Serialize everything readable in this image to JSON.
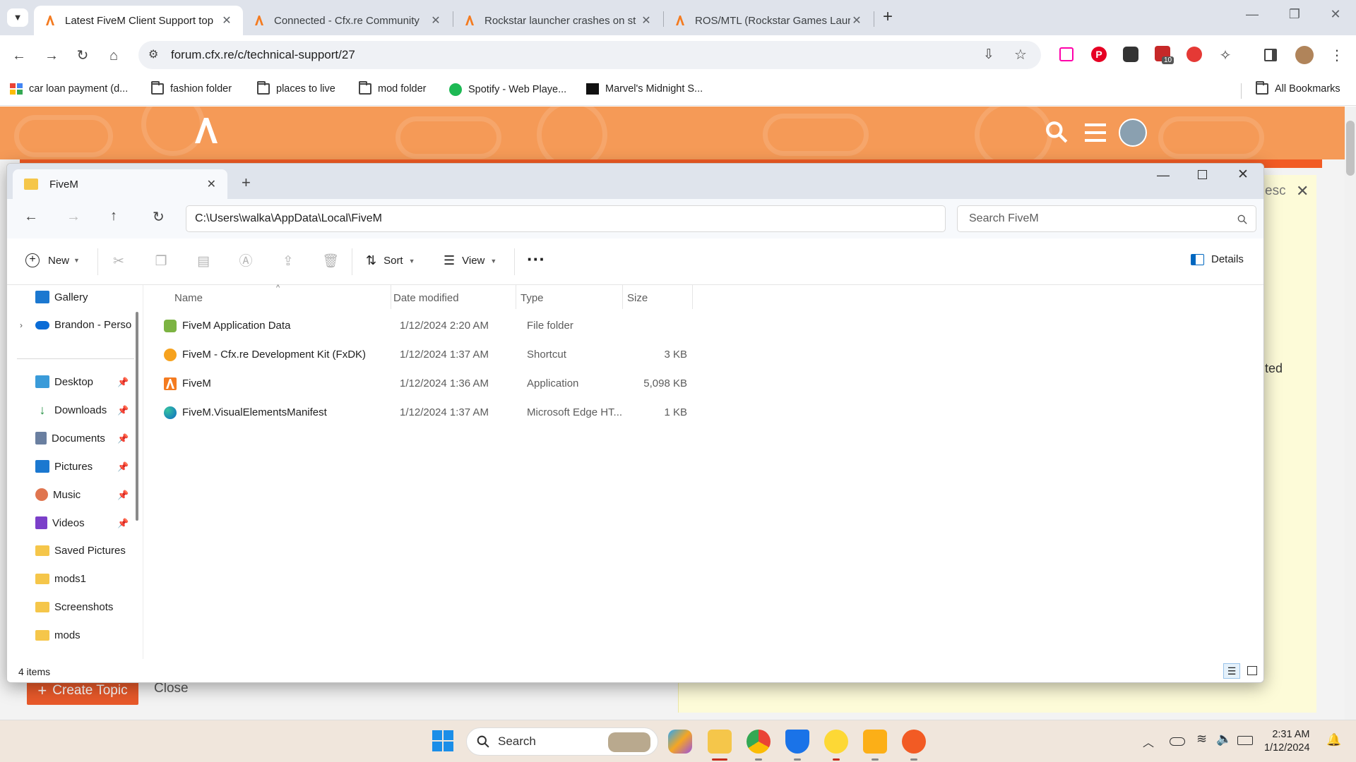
{
  "browser": {
    "tabs": [
      {
        "title": "Latest FiveM Client Support top",
        "active": true
      },
      {
        "title": "Connected - Cfx.re Community",
        "active": false
      },
      {
        "title": "Rockstar launcher crashes on st",
        "active": false
      },
      {
        "title": "ROS/MTL (Rockstar Games Laur",
        "active": false
      }
    ],
    "new_tab_label": "+",
    "url": "forum.cfx.re/c/technical-support/27",
    "extension_badge": "10",
    "bookmarks": [
      {
        "label": "car loan payment (d...",
        "icon": "apps-icon"
      },
      {
        "label": "fashion folder",
        "icon": "folder-icon"
      },
      {
        "label": "places to live",
        "icon": "folder-icon"
      },
      {
        "label": "mod folder",
        "icon": "folder-icon"
      },
      {
        "label": "Spotify - Web Playe...",
        "icon": "spotify-icon"
      },
      {
        "label": "Marvel's Midnight S...",
        "icon": "game-icon"
      }
    ],
    "all_bookmarks_label": "All Bookmarks"
  },
  "page": {
    "esc_label": "esc",
    "partial_text": "ted",
    "create_topic_label": "Create Topic",
    "close_label": "Close",
    "accent_color": "#f59a57"
  },
  "explorer": {
    "tab_title": "FiveM",
    "address": "C:\\Users\\walka\\AppData\\Local\\FiveM",
    "search_placeholder": "Search FiveM",
    "commands": {
      "new_label": "New",
      "sort_label": "Sort",
      "view_label": "View",
      "more_label": "···",
      "details_label": "Details"
    },
    "nav": [
      {
        "label": "Gallery",
        "icon": "gallery-icon",
        "pinned": false
      },
      {
        "label": "Brandon - Perso",
        "icon": "onedrive-icon",
        "pinned": false
      },
      {
        "label": "Desktop",
        "icon": "desktop-icon",
        "pinned": true
      },
      {
        "label": "Downloads",
        "icon": "downloads-icon",
        "pinned": true
      },
      {
        "label": "Documents",
        "icon": "documents-icon",
        "pinned": true
      },
      {
        "label": "Pictures",
        "icon": "pictures-icon",
        "pinned": true
      },
      {
        "label": "Music",
        "icon": "music-icon",
        "pinned": true
      },
      {
        "label": "Videos",
        "icon": "videos-icon",
        "pinned": true
      },
      {
        "label": "Saved Pictures",
        "icon": "folder-icon",
        "pinned": false
      },
      {
        "label": "mods1",
        "icon": "folder-icon",
        "pinned": false
      },
      {
        "label": "Screenshots",
        "icon": "folder-icon",
        "pinned": false
      },
      {
        "label": "mods",
        "icon": "folder-icon",
        "pinned": false
      }
    ],
    "columns": {
      "name": "Name",
      "date": "Date modified",
      "type": "Type",
      "size": "Size"
    },
    "files": [
      {
        "name": "FiveM Application Data",
        "date": "1/12/2024 2:20 AM",
        "type": "File folder",
        "size": "",
        "icon": "fivem-folder-icon"
      },
      {
        "name": "FiveM - Cfx.re Development Kit (FxDK)",
        "date": "1/12/2024 1:37 AM",
        "type": "Shortcut",
        "size": "3 KB",
        "icon": "fxdk-icon"
      },
      {
        "name": "FiveM",
        "date": "1/12/2024 1:36 AM",
        "type": "Application",
        "size": "5,098 KB",
        "icon": "fivem-icon"
      },
      {
        "name": "FiveM.VisualElementsManifest",
        "date": "1/12/2024 1:37 AM",
        "type": "Microsoft Edge HT...",
        "size": "1 KB",
        "icon": "edge-icon"
      }
    ],
    "status": "4 items"
  },
  "taskbar": {
    "search_label": "Search",
    "time": "2:31 AM",
    "date": "1/12/2024"
  }
}
